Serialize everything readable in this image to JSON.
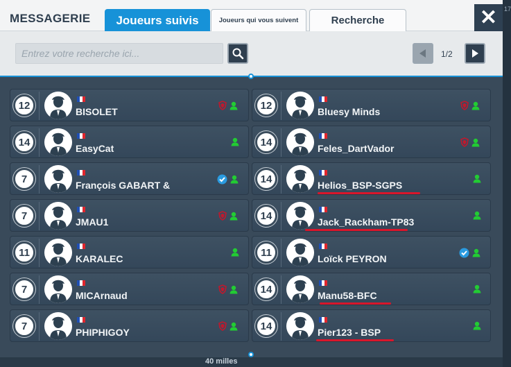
{
  "background": {
    "distance_text": "40 milles",
    "corner_num": "17"
  },
  "header": {
    "title": "MESSAGERIE",
    "tabs": [
      {
        "label": "Joueurs suivis",
        "active": true
      },
      {
        "label": "Joueurs qui vous suivent",
        "active": false
      },
      {
        "label": "Recherche",
        "active": false
      }
    ],
    "close_label": "✕"
  },
  "search": {
    "placeholder": "Entrez votre recherche ici...",
    "value": ""
  },
  "pagination": {
    "text": "1/2"
  },
  "colors": {
    "accent": "#1792d8",
    "online": "#22cc33",
    "shield": "#c0182d",
    "verified": "#2a9be0",
    "underline": "#d9162b"
  },
  "players": [
    {
      "level": "12",
      "name": "BISOLET",
      "shield": true,
      "verified": false,
      "online": true
    },
    {
      "level": "12",
      "name": "Bluesy Minds",
      "shield": true,
      "verified": false,
      "online": true
    },
    {
      "level": "14",
      "name": "EasyCat",
      "shield": false,
      "verified": false,
      "online": true
    },
    {
      "level": "14",
      "name": "Feles_DartVador",
      "shield": true,
      "verified": false,
      "online": true
    },
    {
      "level": "7",
      "name": "François GABART &",
      "shield": false,
      "verified": true,
      "online": true
    },
    {
      "level": "14",
      "name": "Helios_BSP-SGPS",
      "shield": false,
      "verified": false,
      "online": true
    },
    {
      "level": "7",
      "name": "JMAU1",
      "shield": true,
      "verified": false,
      "online": true
    },
    {
      "level": "14",
      "name": "Jack_Rackham-TP83",
      "shield": false,
      "verified": false,
      "online": true
    },
    {
      "level": "11",
      "name": "KARALEC",
      "shield": false,
      "verified": false,
      "online": true
    },
    {
      "level": "11",
      "name": "Loïck PEYRON",
      "shield": false,
      "verified": true,
      "online": true
    },
    {
      "level": "7",
      "name": "MICArnaud",
      "shield": true,
      "verified": false,
      "online": true
    },
    {
      "level": "14",
      "name": "Manu58-BFC",
      "shield": false,
      "verified": false,
      "online": true
    },
    {
      "level": "7",
      "name": "PHIPHIGOY",
      "shield": true,
      "verified": false,
      "online": true
    },
    {
      "level": "14",
      "name": "Pier123 - BSP",
      "shield": false,
      "verified": false,
      "online": true
    }
  ]
}
